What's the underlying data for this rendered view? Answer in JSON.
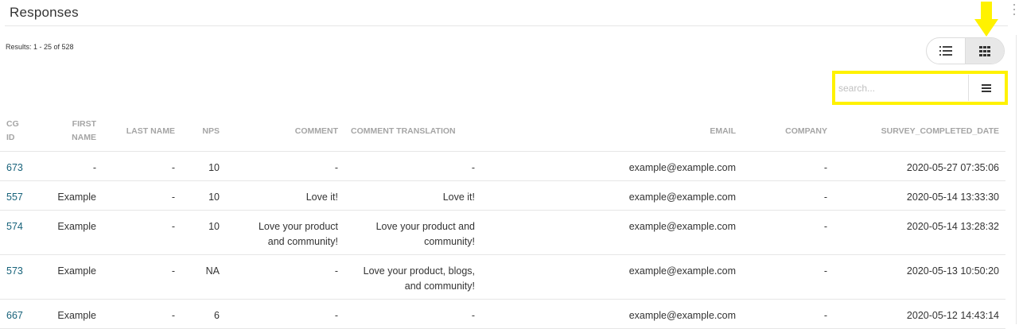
{
  "header": {
    "title": "Responses"
  },
  "results_text": "Results: 1 - 25 of 528",
  "view_toggle": {
    "active": "grid",
    "options": [
      "list-icon",
      "grid-icon"
    ]
  },
  "search": {
    "placeholder": "search...",
    "value": ""
  },
  "highlight_color": "#fff200",
  "link_color": "#17627a",
  "table": {
    "columns": [
      {
        "line1": "CG",
        "line2": "ID"
      },
      {
        "line1": "FIRST",
        "line2": "NAME"
      },
      {
        "line1": "LAST NAME",
        "line2": ""
      },
      {
        "line1": "NPS",
        "line2": ""
      },
      {
        "line1": "COMMENT",
        "line2": ""
      },
      {
        "line1": "COMMENT TRANSLATION",
        "line2": ""
      },
      {
        "line1": "EMAIL",
        "line2": ""
      },
      {
        "line1": "COMPANY",
        "line2": ""
      },
      {
        "line1": "SURVEY_COMPLETED_DATE",
        "line2": ""
      }
    ],
    "rows": [
      {
        "id": "673",
        "first": "-",
        "last": "-",
        "nps": "10",
        "comment": [
          "-",
          ""
        ],
        "translation": [
          "-",
          ""
        ],
        "email": "example@example.com",
        "company": "-",
        "date": "2020-05-27 07:35:06"
      },
      {
        "id": "557",
        "first": "Example",
        "last": "-",
        "nps": "10",
        "comment": [
          "Love it!",
          ""
        ],
        "translation": [
          "Love it!",
          ""
        ],
        "email": "example@example.com",
        "company": "-",
        "date": "2020-05-14 13:33:30"
      },
      {
        "id": "574",
        "first": "Example",
        "last": "-",
        "nps": "10",
        "comment": [
          "Love your product",
          "and community!"
        ],
        "translation": [
          "Love your product and",
          "community!"
        ],
        "email": "example@example.com",
        "company": "-",
        "date": "2020-05-14 13:28:32"
      },
      {
        "id": "573",
        "first": "Example",
        "last": "-",
        "nps": "NA",
        "comment": [
          "-",
          ""
        ],
        "translation": [
          "Love your product, blogs,",
          "and community!"
        ],
        "email": "example@example.com",
        "company": "-",
        "date": "2020-05-13 10:50:20"
      },
      {
        "id": "667",
        "first": "Example",
        "last": "-",
        "nps": "6",
        "comment": [
          "-",
          ""
        ],
        "translation": [
          "-",
          ""
        ],
        "email": "example@example.com",
        "company": "-",
        "date": "2020-05-12 14:43:14"
      }
    ]
  }
}
